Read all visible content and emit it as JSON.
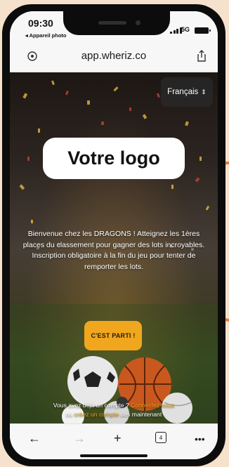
{
  "status_bar": {
    "time": "09:30",
    "back_app": "◂ Appareil photo",
    "network": "5G"
  },
  "browser": {
    "url": "app.wheriz.co",
    "tab_count": "4"
  },
  "page": {
    "language_label": "Français",
    "logo_placeholder": "Votre logo",
    "welcome_text": "Bienvenue chez les DRAGONS ! Atteignez les 1ères places du classement pour gagner des lots incroyables. Inscription obligatoire à la fin du jeu pour tenter de remporter les lots.",
    "cta_label": "C'EST PARTI !",
    "account_prefix": "Vous avez déjà un compte ?",
    "login_link": "Connectez-vous",
    "or_text": "ou",
    "signup_link": "créez un compte",
    "account_suffix": "dès maintenant"
  },
  "colors": {
    "background": "#f6e2cc",
    "accent": "#f0a71e",
    "annotation_arrow": "#e8783a"
  }
}
